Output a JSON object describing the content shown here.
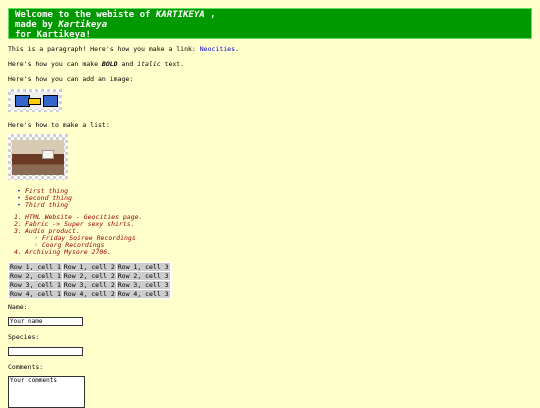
{
  "header": {
    "prefix": "Welcome to the webiste of ",
    "name": "KARTIKEYA",
    "comma": " ,",
    "made_by": "made by ",
    "author": "Kartikeya",
    "for_line": "for Kartikeya!"
  },
  "paragraph": {
    "text": "This is a paragraph! Here's how you make a link: ",
    "link_text": "Neocities",
    "end": "."
  },
  "bold_line": {
    "pre": "Here's how you can make ",
    "bold": "BOLD",
    "mid": " and ",
    "italic": "italic",
    "post": " text."
  },
  "image_line": "Here's how you can add an image:",
  "list_line": "Here's how to make a list:",
  "bullets": [
    "First thing",
    "Second thing",
    "Third thing"
  ],
  "ordered": {
    "items": [
      {
        "num": "1.",
        "text": "HTML Website - Geocities page."
      },
      {
        "num": "2.",
        "text": "Fabric -> Super sexy shirts."
      },
      {
        "num": "3.",
        "text": "Audio product."
      },
      {
        "num": "4.",
        "text": "Archiving Mysore 2706."
      }
    ],
    "sub": [
      "Friday Soiree Recordings",
      "Coorg Recordings"
    ]
  },
  "table": {
    "rows": [
      [
        "Row 1, cell 1",
        "Row 1, cell 2",
        "Row 1, cell 3"
      ],
      [
        "Row 2, cell 1",
        "Row 2, cell 2",
        "Row 2, cell 3"
      ],
      [
        "Row 3, cell 1",
        "Row 3, cell 2",
        "Row 3, cell 3"
      ],
      [
        "Row 4, cell 1",
        "Row 4, cell 2",
        "Row 4, cell 3"
      ]
    ]
  },
  "form": {
    "name_label": "Name:",
    "name_value": "Your name",
    "species_label": "Species:",
    "species_value": "",
    "comments_label": "Comments:",
    "comments_value": "Your comments"
  },
  "colors": {
    "background": "#ffffcc",
    "header_bg": "#009900",
    "list_text": "#990000",
    "link": "#0000cc"
  }
}
